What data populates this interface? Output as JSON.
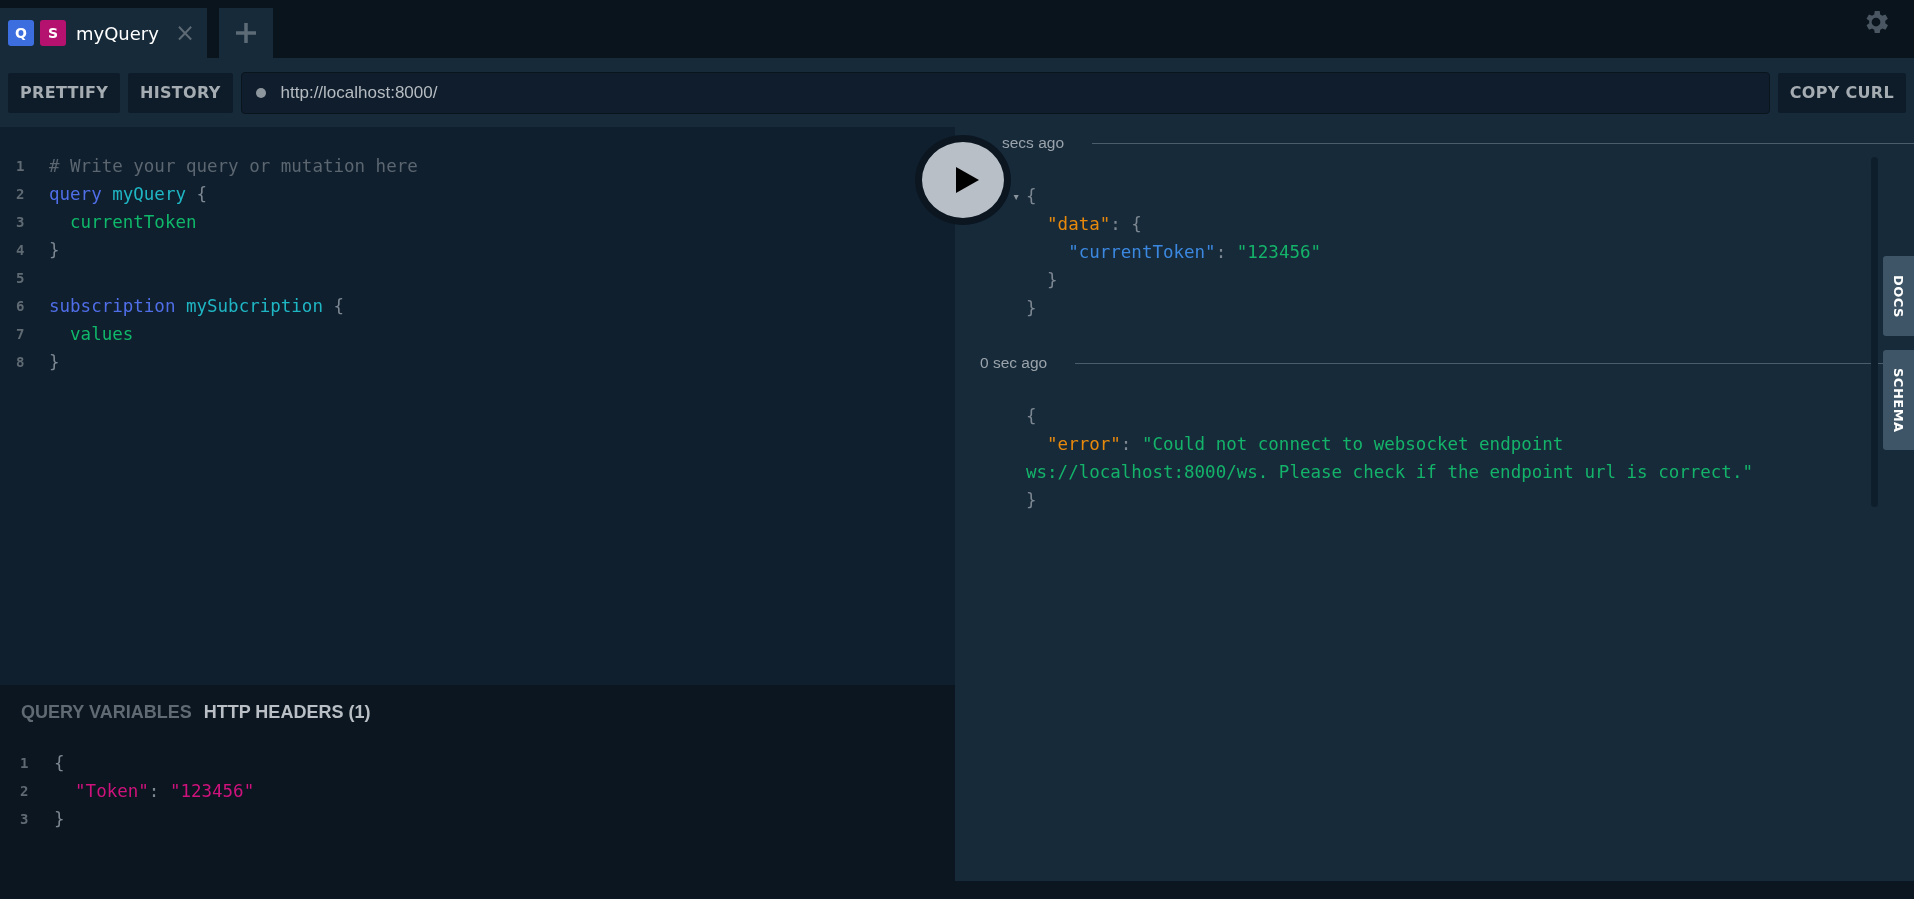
{
  "tabs": [
    {
      "badges": [
        {
          "label": "Q",
          "color": "#3d6ee0"
        },
        {
          "label": "S",
          "color": "#b5116e"
        }
      ],
      "title": "myQuery",
      "close": "×",
      "selected": true
    }
  ],
  "toolbar": {
    "buttons": [
      "PRETTIFY",
      "HISTORY"
    ],
    "url": "http://localhost:8000/",
    "copy": "COPY CURL"
  },
  "editor": {
    "lines": [
      {
        "number": "1",
        "tokens": [
          {
            "text": "# Write your query or mutation here",
            "kind": "comment"
          }
        ]
      },
      {
        "number": "2",
        "tokens": [
          {
            "text": "query",
            "kind": "keyword"
          },
          {
            "text": " myQuery",
            "kind": "name"
          },
          {
            "text": " {",
            "kind": "punct"
          }
        ]
      },
      {
        "number": "3",
        "tokens": [
          {
            "text": "  currentToken",
            "kind": "field"
          }
        ]
      },
      {
        "number": "4",
        "tokens": [
          {
            "text": "}",
            "kind": "punct"
          }
        ]
      },
      {
        "number": "5"
      },
      {
        "number": "6",
        "tokens": [
          {
            "text": "subscription",
            "kind": "keyword"
          },
          {
            "text": " mySubcription",
            "kind": "name"
          },
          {
            "text": " {",
            "kind": "punct"
          }
        ]
      },
      {
        "number": "7",
        "tokens": [
          {
            "text": "  values",
            "kind": "field"
          }
        ]
      },
      {
        "number": "8",
        "tokens": [
          {
            "text": "}",
            "kind": "punct"
          }
        ]
      }
    ]
  },
  "variables": {
    "tabs": [
      {
        "label": "QUERY VARIABLES",
        "selected": false
      },
      {
        "label": "HTTP HEADERS (1)",
        "selected": true
      }
    ],
    "lines": [
      {
        "number": "1",
        "tokens": [
          {
            "text": "{",
            "kind": "punct"
          }
        ]
      },
      {
        "number": "2",
        "tokens": [
          {
            "text": "  \"Token\"",
            "kind": "header"
          },
          {
            "text": ": ",
            "kind": "punct"
          },
          {
            "text": "\"123456\"",
            "kind": "header"
          }
        ]
      },
      {
        "number": "3",
        "tokens": [
          {
            "text": "}",
            "kind": "punct"
          }
        ]
      }
    ]
  },
  "results": [
    {
      "time": "secs ago",
      "lines": [
        {
          "toggle": "▾",
          "tokens": [
            {
              "text": "{",
              "kind": "punct"
            }
          ]
        },
        {
          "tokens": [
            {
              "text": "  \"data\"",
              "kind": "key"
            },
            {
              "text": ": {",
              "kind": "punct"
            }
          ]
        },
        {
          "tokens": [
            {
              "text": "    \"currentToken\"",
              "kind": "subkey"
            },
            {
              "text": ": ",
              "kind": "punct"
            },
            {
              "text": "\"123456\"",
              "kind": "string"
            }
          ]
        },
        {
          "tokens": [
            {
              "text": "  }",
              "kind": "punct"
            }
          ]
        },
        {
          "tokens": [
            {
              "text": "}",
              "kind": "punct"
            }
          ]
        }
      ]
    },
    {
      "time": "0 sec ago",
      "lines": [
        {
          "tokens": [
            {
              "text": "{",
              "kind": "punct"
            }
          ]
        },
        {
          "tokens": [
            {
              "text": "  \"error\"",
              "kind": "key"
            },
            {
              "text": ": ",
              "kind": "punct"
            },
            {
              "text": "\"Could not connect to websocket endpoint",
              "kind": "string"
            }
          ]
        },
        {
          "tokens": [
            {
              "text": "ws://localhost:8000/ws. Please check if the endpoint url is correct.\"",
              "kind": "string"
            }
          ]
        },
        {
          "tokens": [
            {
              "text": "}",
              "kind": "punct"
            }
          ]
        }
      ]
    }
  ],
  "side_tabs": [
    "DOCS",
    "SCHEMA"
  ]
}
